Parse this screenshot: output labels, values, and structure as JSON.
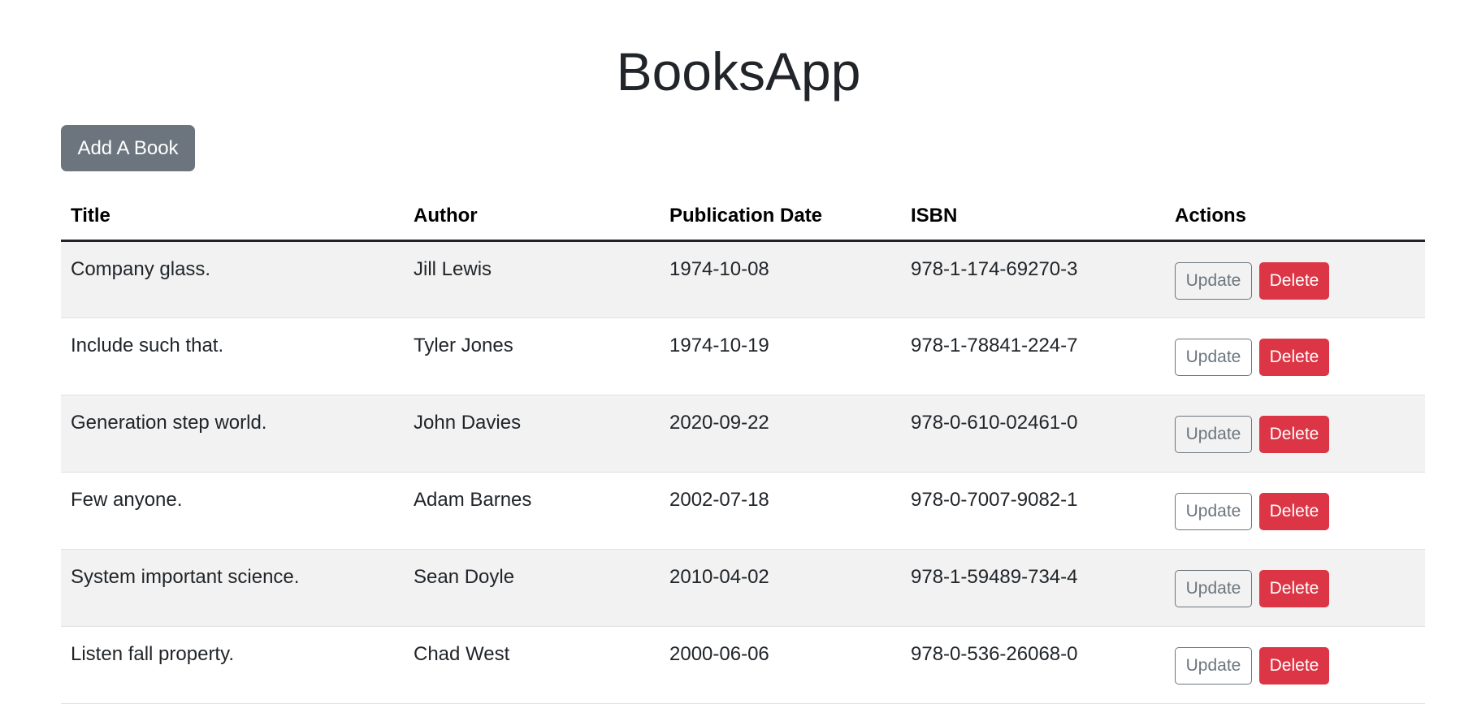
{
  "app": {
    "title": "BooksApp"
  },
  "toolbar": {
    "add_label": "Add A Book"
  },
  "table": {
    "headers": {
      "title": "Title",
      "author": "Author",
      "date": "Publication Date",
      "isbn": "ISBN",
      "actions": "Actions"
    },
    "update_label": "Update",
    "delete_label": "Delete",
    "rows": [
      {
        "title": "Company glass.",
        "author": "Jill Lewis",
        "date": "1974-10-08",
        "isbn": "978-1-174-69270-3"
      },
      {
        "title": "Include such that.",
        "author": "Tyler Jones",
        "date": "1974-10-19",
        "isbn": "978-1-78841-224-7"
      },
      {
        "title": "Generation step world.",
        "author": "John Davies",
        "date": "2020-09-22",
        "isbn": "978-0-610-02461-0"
      },
      {
        "title": "Few anyone.",
        "author": "Adam Barnes",
        "date": "2002-07-18",
        "isbn": "978-0-7007-9082-1"
      },
      {
        "title": "System important science.",
        "author": "Sean Doyle",
        "date": "2010-04-02",
        "isbn": "978-1-59489-734-4"
      },
      {
        "title": "Listen fall property.",
        "author": "Chad West",
        "date": "2000-06-06",
        "isbn": "978-0-536-26068-0"
      }
    ]
  },
  "colors": {
    "secondary": "#6c757d",
    "danger": "#dc3545",
    "stripe": "#f2f2f2",
    "text": "#212529"
  }
}
